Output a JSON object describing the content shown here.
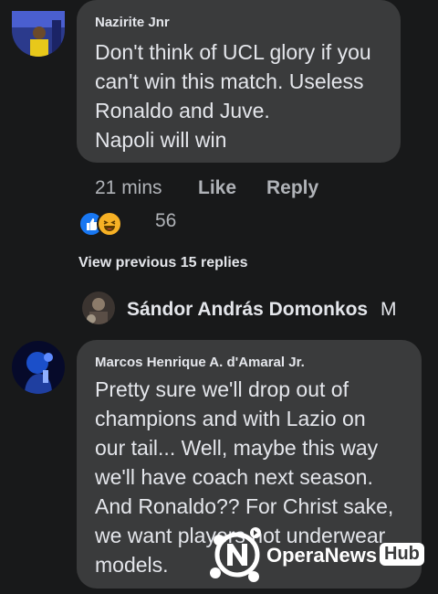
{
  "comment1": {
    "author": "Nazirite Jnr",
    "lines": [
      "Don't think of UCL glory if you",
      "can't win this match. Useless",
      "Ronaldo and Juve.",
      "Napoli will win"
    ],
    "time": "21 mins",
    "like_label": "Like",
    "reply_label": "Reply",
    "reaction_count": "56",
    "reaction_icons": [
      "like-icon",
      "haha-icon"
    ]
  },
  "view_previous": "View previous 15 replies",
  "reply_preview": {
    "author": "Sándor András Domonkos",
    "trailing": "M"
  },
  "comment2": {
    "author": "Marcos Henrique A. d'Amaral Jr.",
    "lines": [
      "Pretty sure we'll drop out of",
      "champions and with Lazio on",
      "our tail... Well, maybe this way",
      "we'll have coach next season.",
      "And Ronaldo?? For Christ sake,",
      "we want players not underwear",
      "models."
    ]
  },
  "watermark": {
    "brand": "OperaNews",
    "badge": "Hub"
  },
  "colors": {
    "background": "#18191a",
    "bubble": "#3a3b3c",
    "secondary_text": "#b0b3b8",
    "like_blue": "#1877f2"
  }
}
